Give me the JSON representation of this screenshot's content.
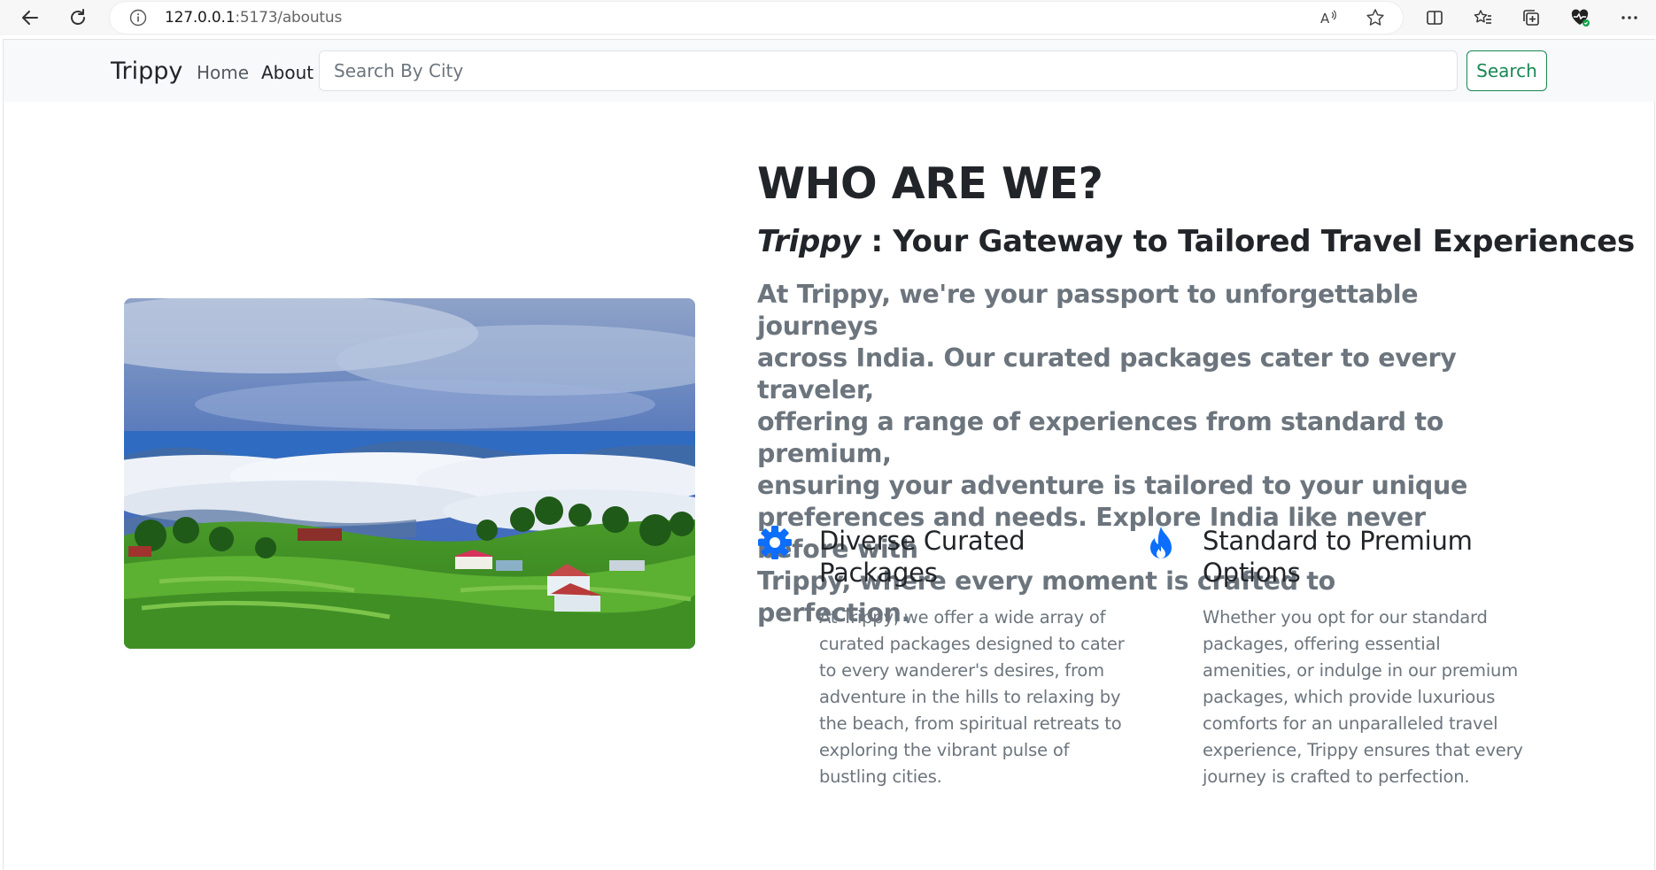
{
  "browser": {
    "url_host": "127.0.0.1",
    "url_rest": ":5173/aboutus"
  },
  "navbar": {
    "brand": "Trippy",
    "links": [
      {
        "label": "Home"
      },
      {
        "label": "About"
      }
    ],
    "search_placeholder": "Search By City",
    "search_button": "Search"
  },
  "about": {
    "heading": "WHO ARE WE?",
    "tagline_brand": "Trippy",
    "tagline_rest": " : Your Gateway to Tailored Travel Experiences",
    "lead_lines": [
      "At Trippy, we're your passport to unforgettable journeys",
      "across India. Our curated packages cater to every traveler,",
      "offering a range of experiences from standard to premium,",
      "ensuring your adventure is tailored to your unique",
      "preferences and needs. Explore India like never before with",
      "Trippy, where every moment is crafted to perfection."
    ],
    "features": [
      {
        "icon": "gear-icon",
        "title_lines": [
          "Diverse Curated",
          "Packages"
        ],
        "body_lines": [
          "At Trippy, we offer a wide array of",
          "curated packages designed to cater",
          "to every wanderer's desires, from",
          "adventure in the hills to relaxing by",
          "the beach, from spiritual retreats to",
          "exploring the vibrant pulse of",
          "bustling cities."
        ]
      },
      {
        "icon": "fire-icon",
        "title_lines": [
          "Standard to Premium",
          "Options"
        ],
        "body_lines": [
          "Whether you opt for our standard",
          "packages, offering essential",
          "amenities, or indulge in our premium",
          "packages, which provide luxurious",
          "comforts for an unparalleled travel",
          "experience, Trippy ensures that every",
          "journey is crafted to perfection."
        ]
      }
    ]
  },
  "colors": {
    "accent_blue": "#0d6efd",
    "success_green": "#198754",
    "muted_text": "#6c757d"
  }
}
